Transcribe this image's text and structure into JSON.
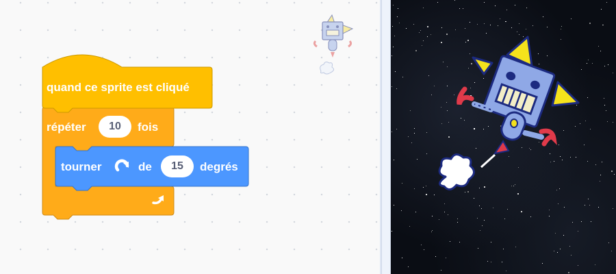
{
  "script": {
    "hat_label": "quand ce sprite est cliqué",
    "repeat": {
      "label": "répéter",
      "count": "10",
      "suffix": "fois"
    },
    "turn": {
      "label": "tourner",
      "preposition": "de",
      "degrees": "15",
      "unit": "degrés",
      "icon": "rotate-right-icon"
    },
    "loop_icon": "loop-arrow-icon"
  },
  "colors": {
    "events": "#ffbf00",
    "control": "#ffab19",
    "motion": "#4c97ff",
    "stage_bg": "#0a0d14"
  },
  "stage": {
    "backdrop": "stars",
    "sprite": "robot-rocket"
  }
}
